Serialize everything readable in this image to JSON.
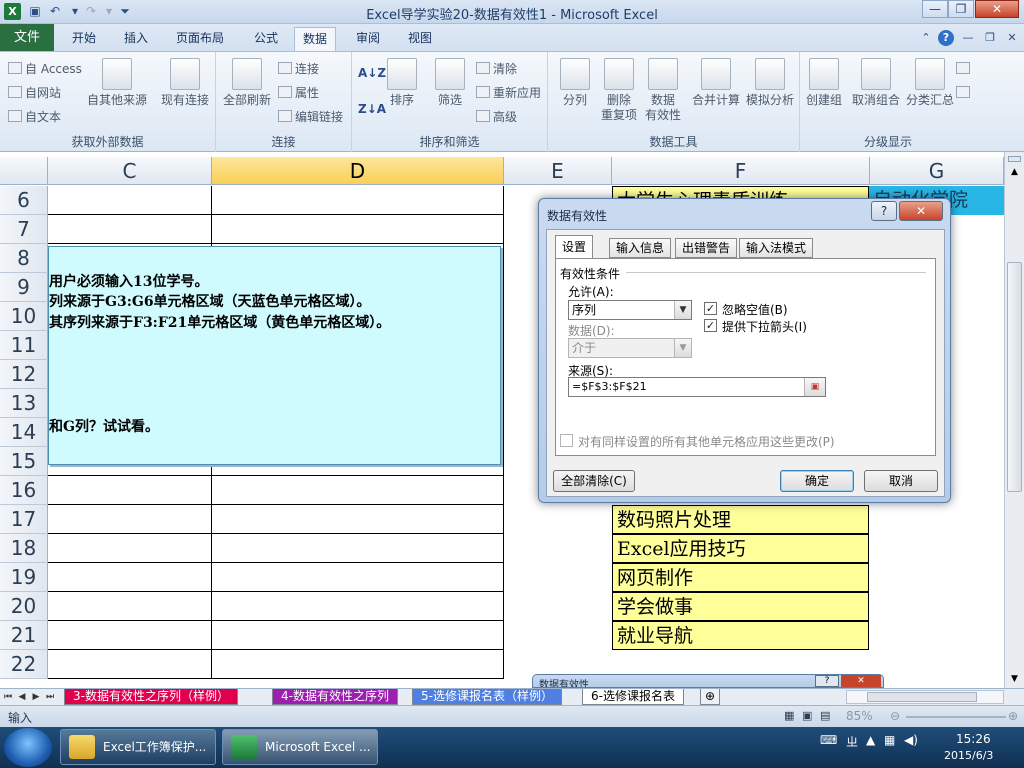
{
  "window": {
    "title": "Excel导学实验20-数据有效性1 - Microsoft Excel",
    "app_icon": "X",
    "controls": {
      "minimize": "—",
      "restore": "❐",
      "close": "✕"
    }
  },
  "ribbon_tabs": [
    "文件",
    "开始",
    "插入",
    "页面布局",
    "公式",
    "数据",
    "审阅",
    "视图"
  ],
  "active_tab": "数据",
  "ribbon": {
    "get_external": {
      "access": "自 Access",
      "web": "自网站",
      "text": "自文本",
      "other": "自其他来源",
      "existing": "现有连接",
      "label": "获取外部数据"
    },
    "connections": {
      "refresh_all": "全部刷新",
      "connections": "连接",
      "properties": "属性",
      "edit_links": "编辑链接",
      "label": "连接"
    },
    "sort_filter": {
      "sort": "排序",
      "filter": "筛选",
      "clear": "清除",
      "reapply": "重新应用",
      "advanced": "高级",
      "label": "排序和筛选"
    },
    "data_tools": {
      "text_to_columns": "分列",
      "remove_dup": "删除\n重复项",
      "validation": "数据\n有效性",
      "consolidate": "合并计算",
      "what_if": "模拟分析",
      "label": "数据工具"
    },
    "outline": {
      "group": "创建组",
      "ungroup": "取消组合",
      "subtotal": "分类汇总",
      "label": "分级显示"
    }
  },
  "sheet": {
    "columns": [
      "C",
      "D",
      "E",
      "F",
      "G"
    ],
    "selected_column": "D",
    "rows": [
      "6",
      "7",
      "8",
      "9",
      "10",
      "11",
      "12",
      "13",
      "14",
      "15",
      "16",
      "17",
      "18",
      "19",
      "20",
      "21",
      "22"
    ],
    "f_cells": {
      "r6": "大学生心理素质训练",
      "r17": "数码照片处理",
      "r18": "Excel应用技巧",
      "r19": "网页制作",
      "r20": "学会做事",
      "r21": "就业导航"
    },
    "g_cells": {
      "r6": "自动化学院"
    }
  },
  "note": {
    "line1": "用户必须输入13位学号。",
    "line2": "列来源于G3:G6单元格区域（天蓝色单元格区域）。",
    "line3": "其序列来源于F3:F21单元格区域（黄色单元格区域）。",
    "line4": "和G列？试试看。"
  },
  "dialog": {
    "title": "数据有效性",
    "help": "?",
    "close": "✕",
    "tabs": [
      "设置",
      "输入信息",
      "出错警告",
      "输入法模式"
    ],
    "section_title": "有效性条件",
    "allow_label": "允许(A):",
    "allow_value": "序列",
    "ignore_blank": "忽略空值(B)",
    "dropdown": "提供下拉箭头(I)",
    "data_label": "数据(D):",
    "data_value": "介于",
    "source_label": "来源(S):",
    "source_value": "=$F$3:$F$21",
    "apply_all": "对有同样设置的所有其他单元格应用这些更改(P)",
    "clear_all": "全部清除(C)",
    "ok": "确定",
    "cancel": "取消"
  },
  "dialog_behind": {
    "title": "数据有效性"
  },
  "sheet_tabs": [
    "3-数据有效性之序列（样例）",
    "4-数据有效性之序列",
    "5-选修课报名表（样例）",
    "6-选修课报名表"
  ],
  "active_sheet": "6-选修课报名表",
  "status": {
    "mode": "输入",
    "zoom": "85%"
  },
  "taskbar": {
    "items": [
      "Excel工作簿保护...",
      "Microsoft Excel ..."
    ],
    "time": "15:26",
    "date": "2015/6/3"
  },
  "colors": {
    "yellow_cells": "#ffff99",
    "blue_cells": "#27b6e6",
    "note_bg": "#cffafe",
    "file_tab": "#2a6f3f"
  }
}
